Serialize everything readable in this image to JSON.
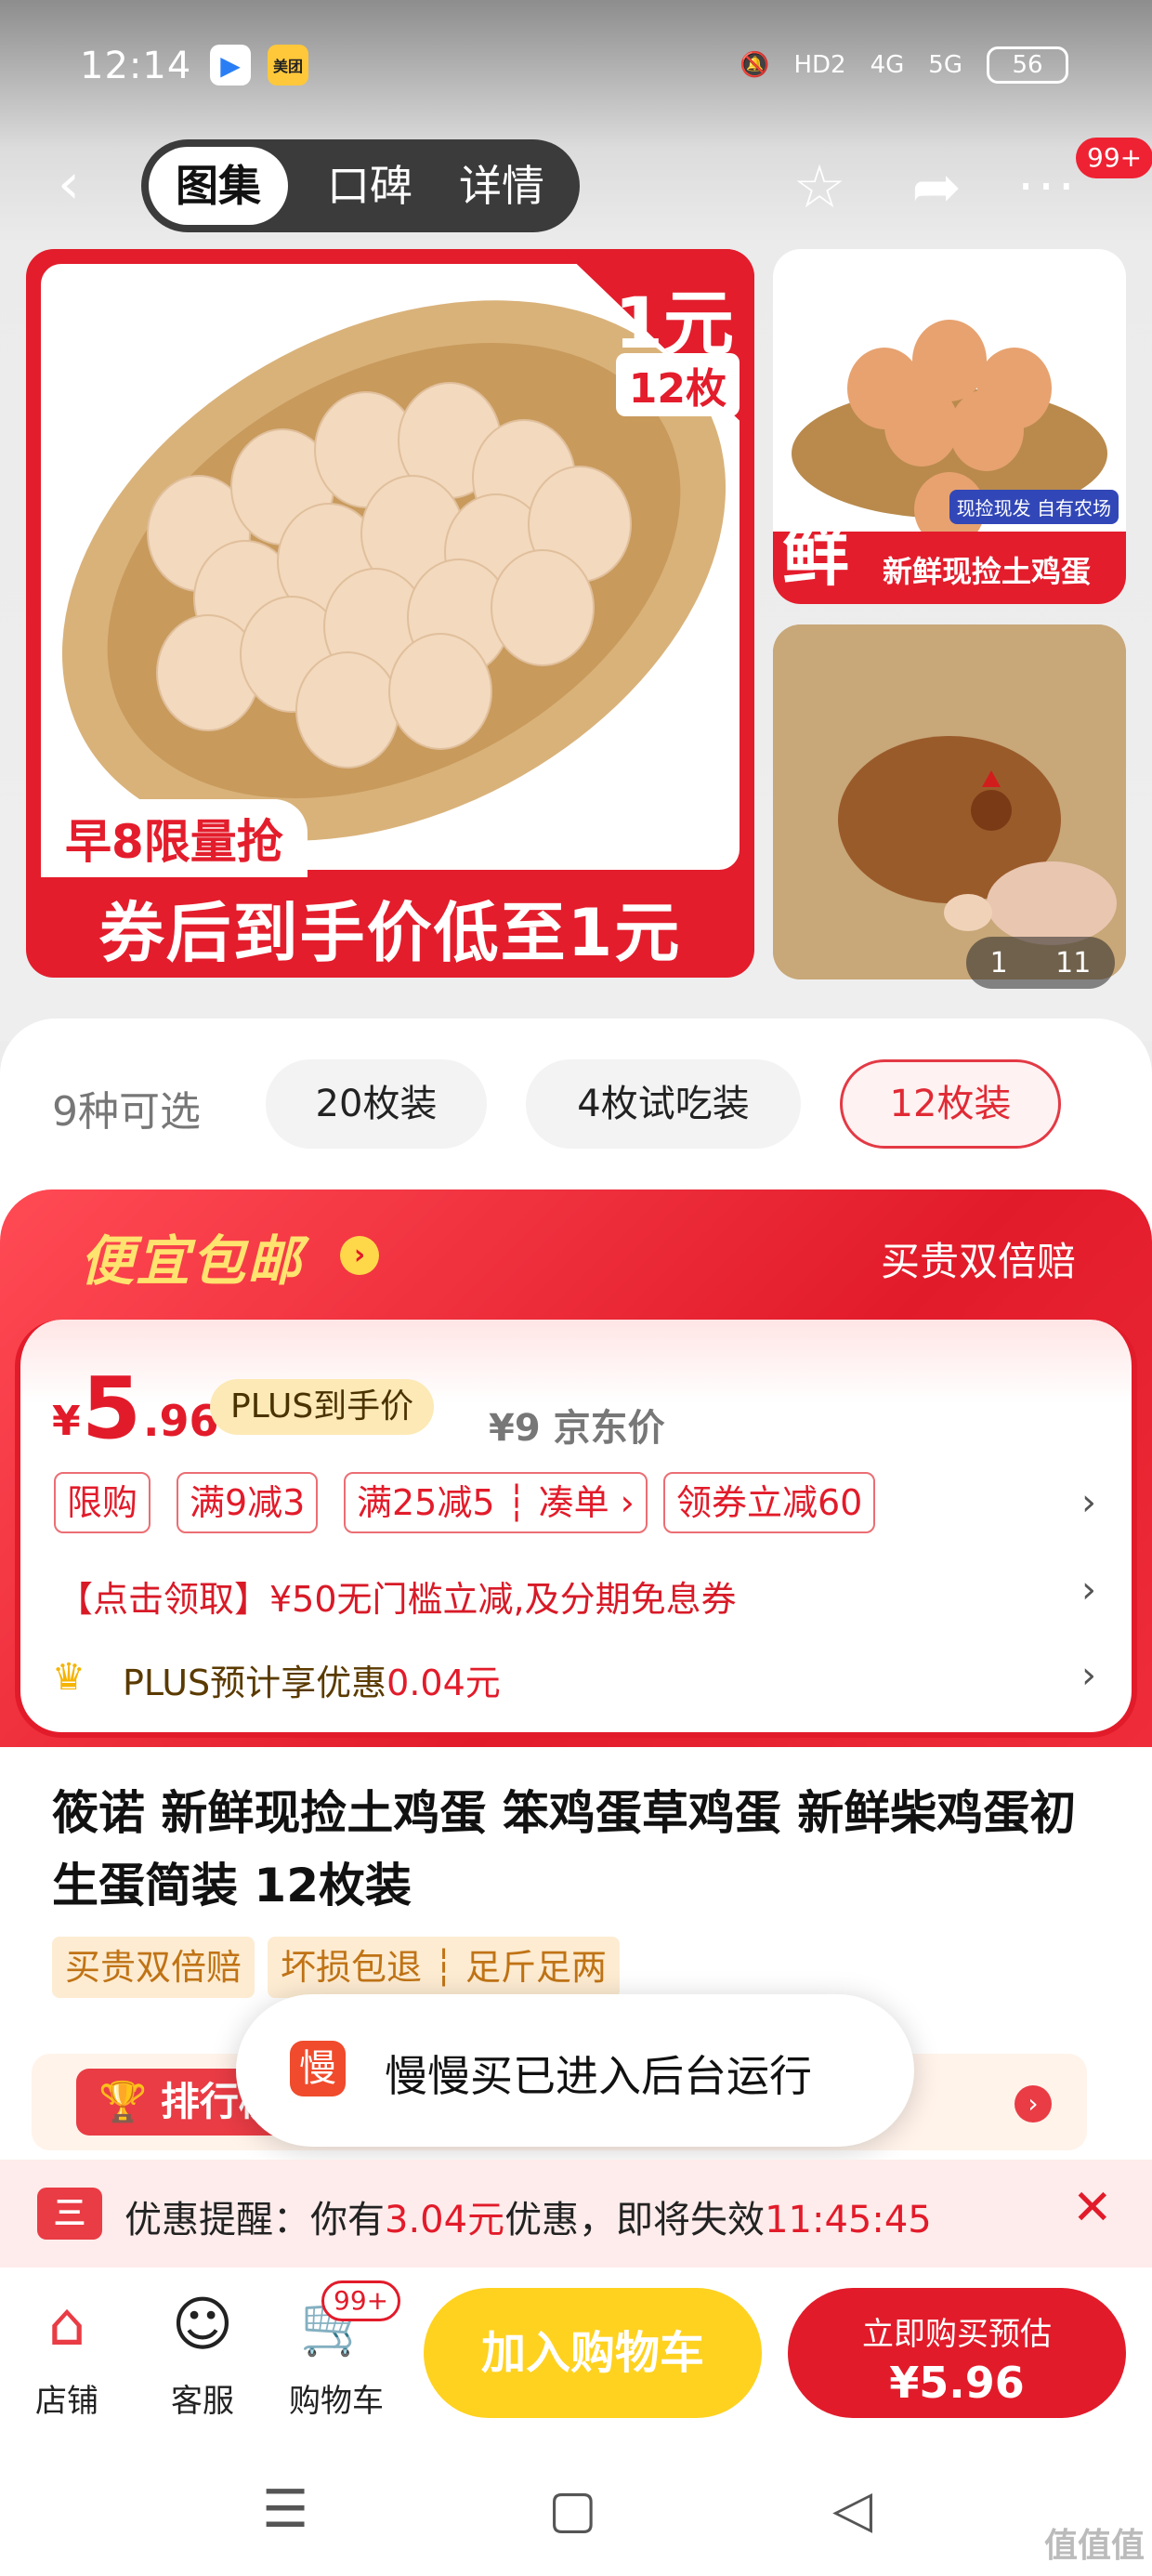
{
  "status_bar": {
    "time": "12:14",
    "app1": "▶",
    "app2": "美团",
    "mute": "🔕",
    "hd": "HD2",
    "net1": "4G",
    "net2": "5G",
    "battery": "56"
  },
  "nav": {
    "back": "‹",
    "tabs": [
      "图集",
      "口碑",
      "详情"
    ],
    "star": "☆",
    "share": "➦",
    "more": "···",
    "more_badge": "99+"
  },
  "gallery": {
    "main_price": "1元",
    "main_count": "12枚",
    "main_early": "早8限量抢",
    "main_coupon": "券后到手价低至1元",
    "side1_char": "鲜",
    "side1_label": "新鲜现捡土鸡蛋",
    "side1_small": "现捡现发 自有农场",
    "pager_current": "1",
    "pager_total": "11"
  },
  "options": {
    "count_label": "9种可选",
    "chips": [
      "20枚装",
      "4枚试吃装",
      "12枚装"
    ],
    "selected": "12枚装"
  },
  "promo": {
    "title": "便宜包邮",
    "arrow": "›",
    "right": "买贵双倍赔"
  },
  "price": {
    "yen": "¥",
    "integer": "5",
    "decimal": ".96",
    "plus_tag": "PLUS到手价",
    "jd_price": "¥9 京东价",
    "tags": [
      "限购",
      "满9减3",
      "满25减5 ┆ 凑单 ›",
      "领券立减60"
    ],
    "row1": "【点击领取】¥50无门槛立减,及分期免息券",
    "row2_prefix": "PLUS预计享优惠",
    "row2_value": "0.04元",
    "chevron": "›"
  },
  "product": {
    "title": "筱诺 新鲜现捡土鸡蛋 笨鸡蛋草鸡蛋 新鲜柴鸡蛋初生蛋简装 12枚装",
    "badges": [
      "买贵双倍赔",
      "坏损包退 ┆ 足斤足两"
    ]
  },
  "ranking": {
    "label": "🏆 排行榜",
    "arrow": "›"
  },
  "toast": {
    "icon": "慢",
    "text": "慢慢买已进入后台运行"
  },
  "reminder": {
    "icon": "三",
    "prefix": "优惠提醒：你有",
    "amount": "3.04元",
    "middle": "优惠，即将失效",
    "countdown": "11:45:45",
    "close": "✕"
  },
  "actions": {
    "items": [
      {
        "icon": "⌂",
        "label": "店铺"
      },
      {
        "icon": "☺",
        "label": "客服"
      },
      {
        "icon": "🛒",
        "label": "购物车"
      }
    ],
    "cart_badge": "99+",
    "add_cart": "加入购物车",
    "buy_top": "立即购买预估",
    "buy_price": "¥5.96"
  },
  "sysnav": {
    "menu": "☰",
    "home": "▢",
    "back": "◁"
  },
  "watermark": "值值值"
}
